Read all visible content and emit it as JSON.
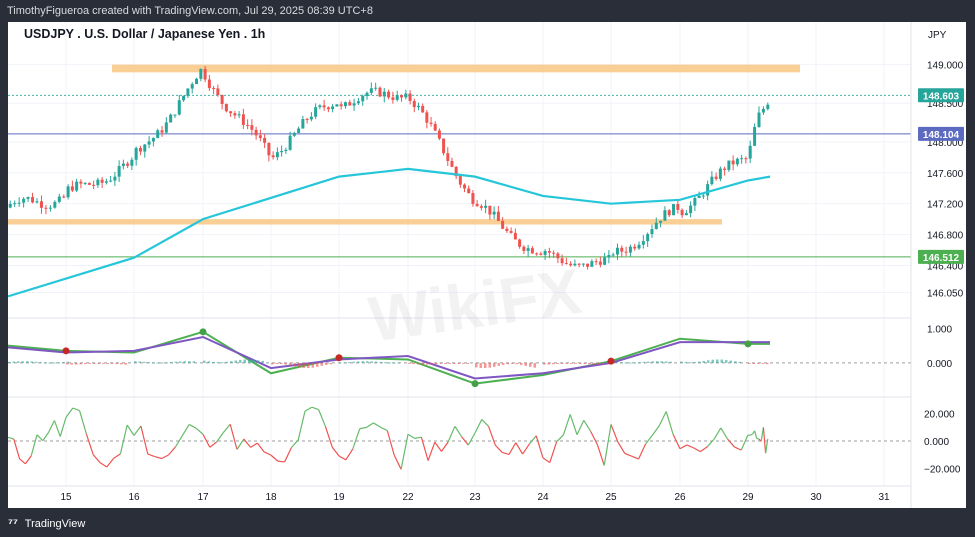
{
  "header": {
    "credit": "TimothyFigueroa created with TradingView.com, Jul 29, 2025 08:39 UTC+8"
  },
  "footer": {
    "brand": "TradingView",
    "logo_icon": "tradingview-logo-icon"
  },
  "watermark": "WikiFX",
  "colors": {
    "up": "#26a69a",
    "down": "#ef5350",
    "ma": "#26c6da",
    "zone": "#f9c784",
    "blue_line": "#7e57c2",
    "green_line": "#4caf50",
    "cross_red": "#c62828",
    "cross_green": "#43a047"
  },
  "chart_data": [
    {
      "type": "candlestick",
      "title": "USDJPY . U.S. Dollar / Japanese Yen . 1h",
      "currency": "JPY",
      "y_ticks": [
        "149.000",
        "148.500",
        "148.000",
        "147.600",
        "147.200",
        "146.800",
        "146.400",
        "146.050"
      ],
      "ylim": [
        145.72,
        149.5
      ],
      "x_ticks": [
        "15",
        "16",
        "17",
        "18",
        "19",
        "22",
        "23",
        "24",
        "25",
        "26",
        "29",
        "30",
        "31"
      ],
      "price_labels": [
        {
          "value": 148.603,
          "text": "148.603",
          "color": "#26a69a"
        },
        {
          "value": 148.104,
          "text": "148.104",
          "color": "#5c6bc0"
        },
        {
          "value": 146.512,
          "text": "146.512",
          "color": "#4caf50"
        }
      ],
      "zones": [
        {
          "from_day": "16",
          "to_day": "30",
          "low": 148.9,
          "high": 149.0
        },
        {
          "from_day": "14",
          "to_day": "26",
          "low": 146.93,
          "high": 147.0
        }
      ],
      "daily_closes": [
        {
          "day": "14",
          "close": 147.3
        },
        {
          "day": "15",
          "close": 147.75
        },
        {
          "day": "16",
          "close": 148.85
        },
        {
          "day": "17",
          "close": 147.8
        },
        {
          "day": "18",
          "close": 148.55
        },
        {
          "day": "19",
          "close": 148.65
        },
        {
          "day": "22",
          "close": 147.3
        },
        {
          "day": "23",
          "close": 146.55
        },
        {
          "day": "24",
          "close": 146.4
        },
        {
          "day": "25",
          "close": 147.1
        },
        {
          "day": "26",
          "close": 147.8
        },
        {
          "day": "29",
          "close": 148.6
        }
      ],
      "ma_series": [
        {
          "day": "14",
          "value": 146.0
        },
        {
          "day": "16",
          "value": 146.5
        },
        {
          "day": "17",
          "value": 147.0
        },
        {
          "day": "19",
          "value": 147.55
        },
        {
          "day": "22",
          "value": 147.65
        },
        {
          "day": "23",
          "value": 147.55
        },
        {
          "day": "24",
          "value": 147.3
        },
        {
          "day": "25",
          "value": 147.2
        },
        {
          "day": "26",
          "value": 147.25
        },
        {
          "day": "29",
          "value": 147.5
        }
      ]
    },
    {
      "type": "line",
      "y_ticks": [
        "1.000",
        "0.000"
      ],
      "ylim": [
        -0.9,
        1.3
      ],
      "x": [
        "14",
        "15",
        "16",
        "17",
        "18",
        "19",
        "22",
        "23",
        "24",
        "25",
        "26",
        "29"
      ],
      "series": [
        {
          "values": [
            0.5,
            0.35,
            0.3,
            0.9,
            -0.3,
            0.15,
            0.1,
            -0.6,
            -0.35,
            0.05,
            0.7,
            0.55
          ]
        },
        {
          "values": [
            0.45,
            0.3,
            0.35,
            0.75,
            -0.15,
            0.1,
            0.2,
            -0.45,
            -0.3,
            0.0,
            0.6,
            0.6
          ]
        }
      ],
      "histogram": [
        0.05,
        -0.05,
        0.05,
        0.1,
        -0.15,
        0.05,
        -0.05,
        -0.15,
        -0.05,
        0.05,
        0.1,
        -0.05
      ]
    },
    {
      "type": "line",
      "y_ticks": [
        "20.000",
        "0.000",
        "−20.000"
      ],
      "ylim": [
        -30,
        30
      ],
      "x": [
        "14",
        "15",
        "16",
        "17",
        "18",
        "19",
        "22",
        "23",
        "24",
        "25",
        "26",
        "29"
      ],
      "series": [
        {
          "values": [
            -10,
            18,
            12,
            -8,
            20,
            16,
            -6,
            10,
            -12,
            14,
            6,
            4
          ]
        }
      ]
    }
  ]
}
